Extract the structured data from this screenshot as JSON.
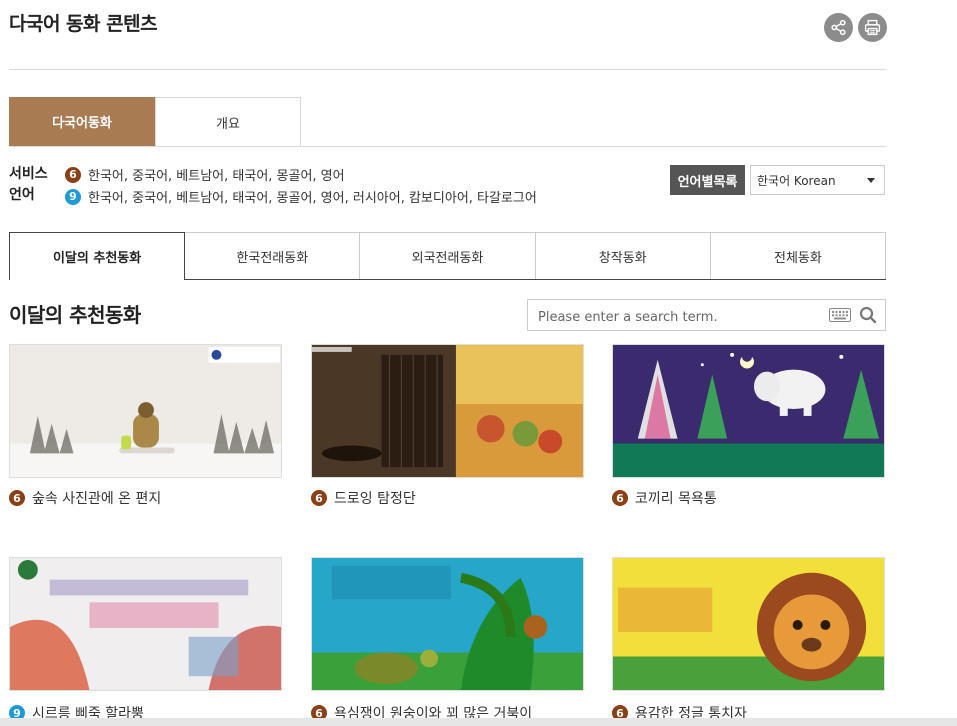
{
  "header": {
    "title": "다국어 동화 콘텐츠",
    "share_icon": "share-icon",
    "print_icon": "print-icon"
  },
  "main_tabs": [
    {
      "label": "다국어동화",
      "active": true
    },
    {
      "label": "개요",
      "active": false
    }
  ],
  "service": {
    "label": "서비스 언어",
    "lines": [
      {
        "badge": "6",
        "text": "한국어, 중국어, 베트남어, 태국어, 몽골어, 영어"
      },
      {
        "badge": "9",
        "text": "한국어, 중국어, 베트남어, 태국어, 몽골어, 영어, 러시아어, 캄보디아어, 타갈로그어"
      }
    ]
  },
  "language_filter": {
    "label": "언어별목록",
    "selected": "한국어 Korean"
  },
  "category_tabs": [
    "이달의 추천동화",
    "한국전래동화",
    "외국전래동화",
    "창작동화",
    "전체동화"
  ],
  "section": {
    "title": "이달의 추천동화"
  },
  "search": {
    "placeholder": "Please enter a search term.",
    "keyboard_icon": "keyboard-icon",
    "search_icon": "search-icon"
  },
  "cards": [
    {
      "badge": "6",
      "title": "숲속 사진관에 온 편지",
      "cover_text": "숲속 사진관에 온 편지"
    },
    {
      "badge": "6",
      "title": "드로잉 탐정단",
      "cover_text": "드로잉 탐정단"
    },
    {
      "badge": "6",
      "title": "코끼리 목욕통",
      "cover_text": "코끼리 목욕통"
    },
    {
      "badge": "9",
      "title": "시르릉 삐죽 할라뿡",
      "cover_text": "시르릉 삐죽 할라뿡"
    },
    {
      "badge": "6",
      "title": "욕심쟁이 원숭이와 꾀 많은 거북이",
      "cover_text": "욕심쟁이 원숭이와 꾀 많은 거북이"
    },
    {
      "badge": "6",
      "title": "용감한 정글 통치자",
      "cover_text": "용감한 정글 통치자"
    }
  ],
  "colors": {
    "accent": "#a87b52",
    "badge6": "#8b3f14",
    "badge9": "#1f9ad6",
    "filter_label": "#555555"
  }
}
